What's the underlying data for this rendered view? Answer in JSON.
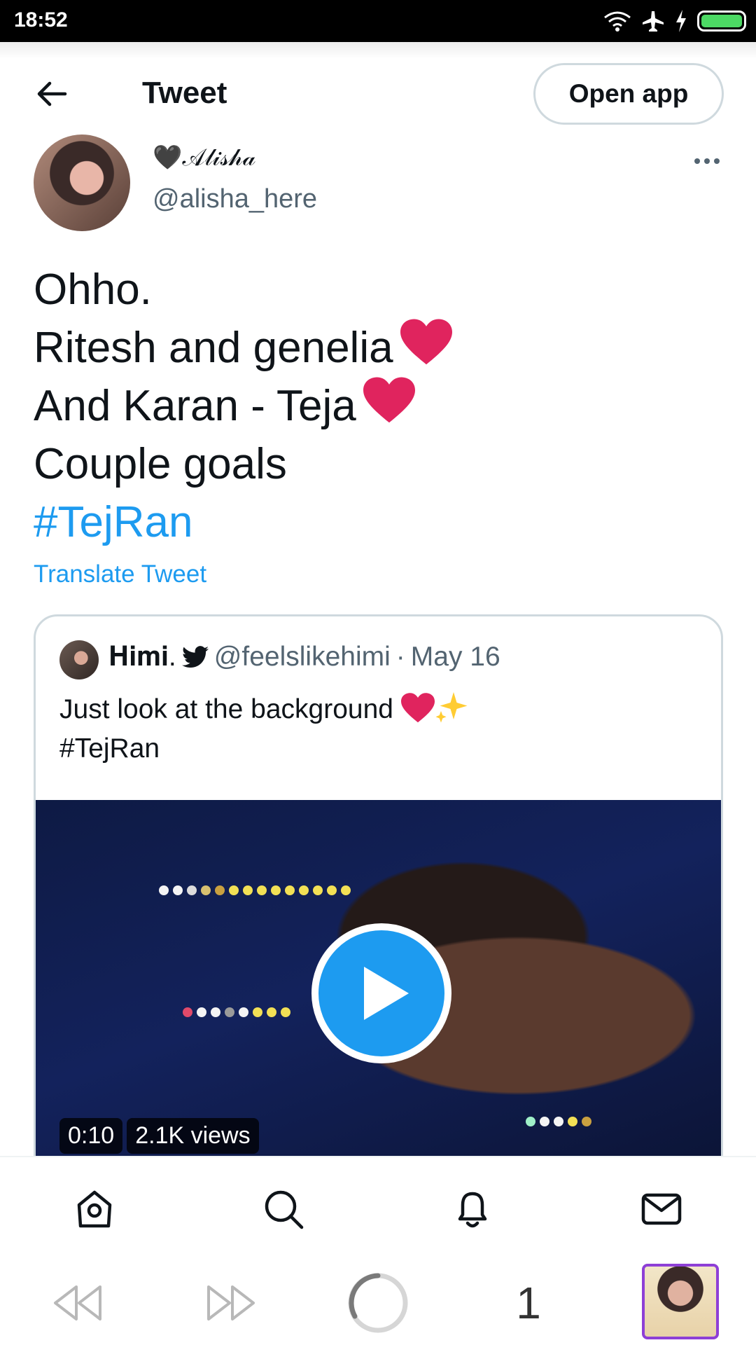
{
  "status_bar": {
    "time": "18:52"
  },
  "header": {
    "title": "Tweet",
    "open_app_label": "Open app"
  },
  "author": {
    "display_name": "🖤𝒜𝓁𝒾𝓈𝒽𝒶",
    "handle": "@alisha_here"
  },
  "tweet": {
    "lines": [
      "Ohho.",
      "Ritesh and genelia",
      "And Karan - Teja",
      "Couple goals"
    ],
    "hashtag": "#TejRan",
    "translate_label": "Translate Tweet",
    "heart_color": "#e0245e"
  },
  "quoted": {
    "display_name": "𝐇𝐢𝐦𝐢.",
    "handle": "@feelslikehimi",
    "date": "May 16",
    "text_line": "Just look at the background",
    "hashtag": "#TejRan",
    "video": {
      "duration": "0:10",
      "views": "2.1K views"
    }
  },
  "bottom_nav": {
    "items": [
      "home-icon",
      "search-icon",
      "notifications-icon",
      "messages-icon"
    ]
  },
  "browser_bar": {
    "tab_count": "1"
  },
  "colors": {
    "accent": "#1d9bf0",
    "secondary_text": "#536471",
    "border": "#cfd9de"
  }
}
